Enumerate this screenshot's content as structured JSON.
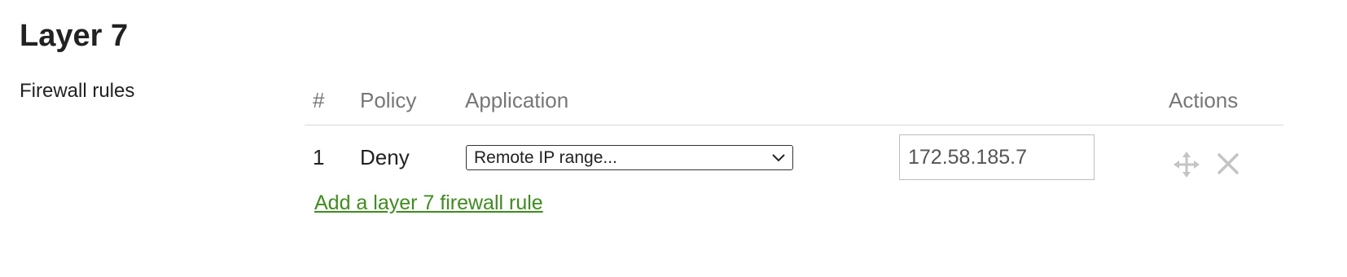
{
  "section": {
    "title": "Layer 7",
    "row_label": "Firewall rules"
  },
  "table": {
    "headers": {
      "number": "#",
      "policy": "Policy",
      "application": "Application",
      "actions": "Actions"
    },
    "rows": [
      {
        "number": "1",
        "policy": "Deny",
        "application": "Remote IP range...",
        "value": "172.58.185.7"
      }
    ]
  },
  "icons": {
    "dropdown": "chevron-down-icon",
    "move": "move-icon",
    "delete": "close-icon"
  },
  "add_rule_link": "Add a layer 7 firewall rule",
  "colors": {
    "link": "#3b8f1a",
    "header_text": "#777777",
    "icon_gray": "#c4c4c4"
  }
}
